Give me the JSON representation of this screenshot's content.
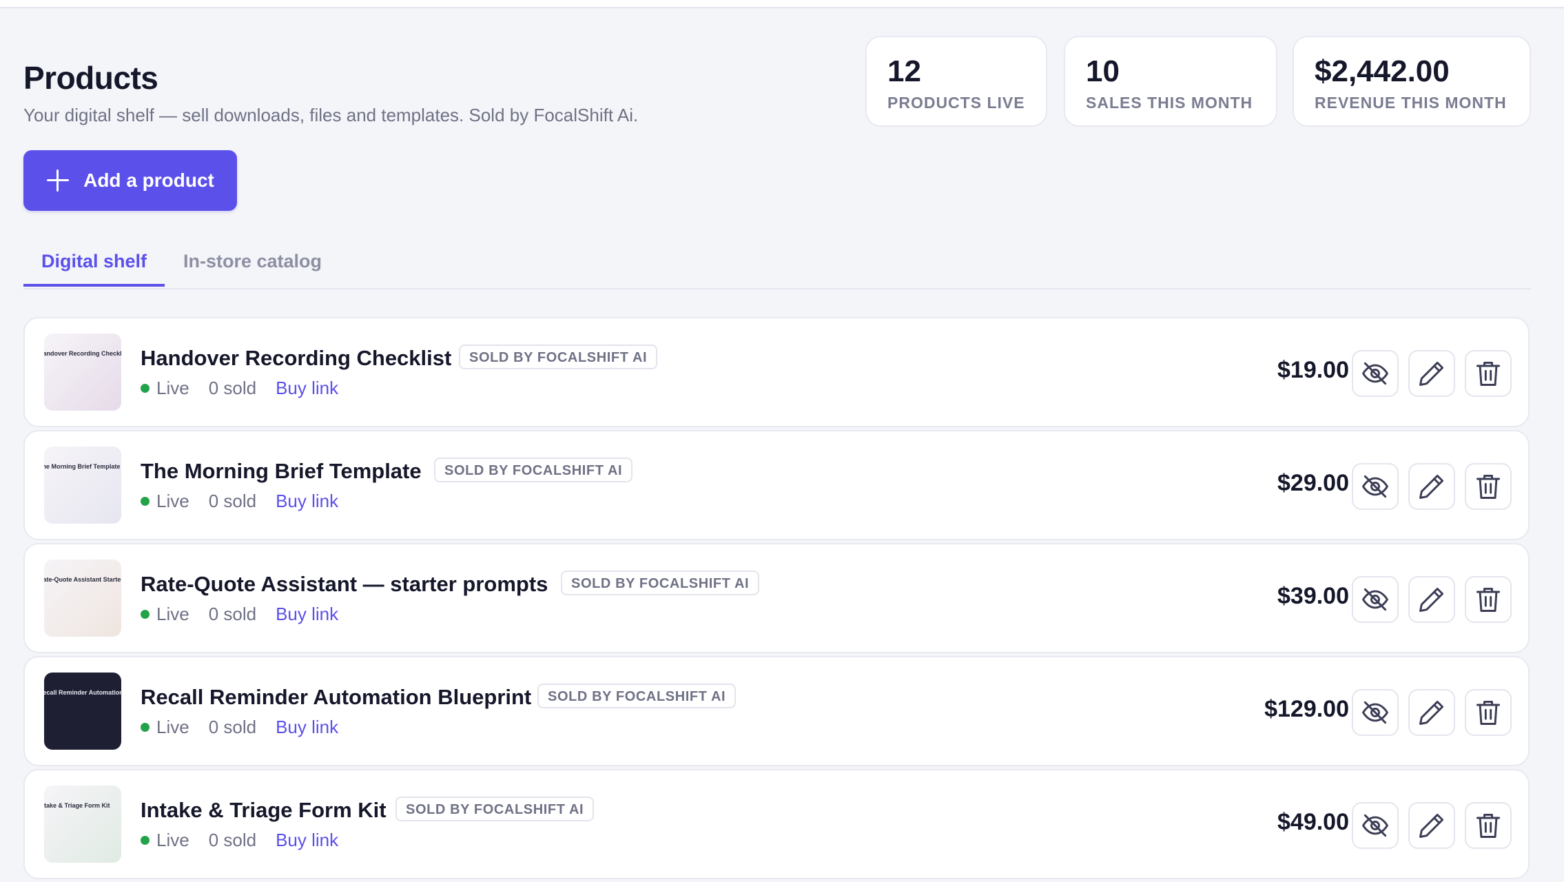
{
  "header": {
    "title": "Products",
    "subtitle": "Your digital shelf — sell downloads, files and templates. Sold by FocalShift Ai.",
    "add_button": "Add a product"
  },
  "stats": [
    {
      "value": "12",
      "label": "PRODUCTS LIVE"
    },
    {
      "value": "10",
      "label": "SALES THIS MONTH"
    },
    {
      "value": "$2,442.00",
      "label": "REVENUE THIS MONTH"
    }
  ],
  "tabs": [
    {
      "label": "Digital shelf",
      "active": true
    },
    {
      "label": "In-store catalog",
      "active": false
    }
  ],
  "products": [
    {
      "name": "Handover Recording Checklist",
      "badge": "SOLD BY FOCALSHIFT AI",
      "status": "Live",
      "sold": "0 sold",
      "link": "Buy link",
      "price": "$19.00",
      "thumb_title": "Handover Recording Checklist",
      "thumb_color": "#e6dbe9"
    },
    {
      "name": "The Morning Brief Template",
      "badge": "SOLD BY FOCALSHIFT AI",
      "status": "Live",
      "sold": "0 sold",
      "link": "Buy link",
      "price": "$29.00",
      "thumb_title": "The Morning Brief Template",
      "thumb_color": "#e6e6f0"
    },
    {
      "name": "Rate-Quote Assistant — starter prompts",
      "badge": "SOLD BY FOCALSHIFT AI",
      "status": "Live",
      "sold": "0 sold",
      "link": "Buy link",
      "price": "$39.00",
      "thumb_title": "Rate-Quote Assistant Starters",
      "thumb_color": "#efe5df"
    },
    {
      "name": "Recall Reminder Automation Blueprint",
      "badge": "SOLD BY FOCALSHIFT AI",
      "status": "Live",
      "sold": "0 sold",
      "link": "Buy link",
      "price": "$129.00",
      "thumb_title": "Recall Reminder Automation",
      "thumb_color": "#1e1f33"
    },
    {
      "name": "Intake & Triage Form Kit",
      "badge": "SOLD BY FOCALSHIFT AI",
      "status": "Live",
      "sold": "0 sold",
      "link": "Buy link",
      "price": "$49.00",
      "thumb_title": "Intake & Triage Form Kit",
      "thumb_color": "#e0ebe3"
    }
  ],
  "icons": {
    "hide": "eye-off-icon",
    "edit": "pencil-icon",
    "delete": "trash-icon",
    "add": "plus-icon"
  },
  "colors": {
    "accent": "#5b50ea",
    "live": "#22a34a",
    "background": "#f4f5f9"
  }
}
